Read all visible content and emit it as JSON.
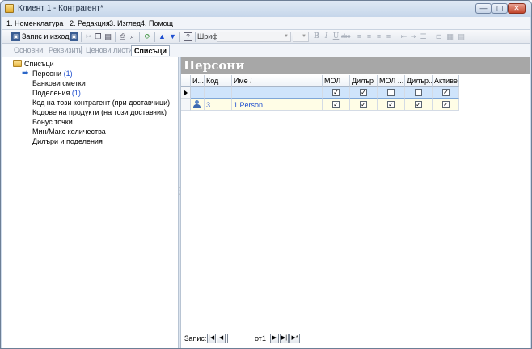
{
  "window": {
    "title": "Клиент 1 - Контрагент*",
    "min_glyph": "—",
    "max_glyph": "▢",
    "close_glyph": "✕"
  },
  "menu": [
    {
      "key": "1",
      "label": "1. Номенклатура"
    },
    {
      "key": "2",
      "label": "2. Редакция"
    },
    {
      "key": "3",
      "label": "3. Изглед"
    },
    {
      "key": "4",
      "label": "4. Помощ"
    }
  ],
  "toolbar": {
    "save_exit_label": "Запис и изход",
    "font_label": "Шрифт:",
    "bold": "B",
    "italic": "I",
    "underline": "U",
    "strike": "abc"
  },
  "tabs": [
    {
      "label": "Основни",
      "active": false
    },
    {
      "label": "Реквизити",
      "active": false
    },
    {
      "label": "Ценови листи",
      "active": false
    },
    {
      "label": "Списъци",
      "active": true
    }
  ],
  "tree": {
    "root": "Списъци",
    "items": [
      {
        "label": "Персони",
        "count": "(1)",
        "selected": true
      },
      {
        "label": "Банкови сметки",
        "count": ""
      },
      {
        "label": "Поделения",
        "count": "(1)"
      },
      {
        "label": "Код на този контрагент (при доставчици)",
        "count": ""
      },
      {
        "label": "Кодове на продукти (на този доставчик)",
        "count": ""
      },
      {
        "label": "Бонус точки",
        "count": ""
      },
      {
        "label": "Мин/Макс количества",
        "count": ""
      },
      {
        "label": "Дилъри и поделения",
        "count": ""
      }
    ]
  },
  "grid": {
    "title": "Персони",
    "columns": [
      "И...",
      "Код",
      "Име",
      "МОЛ",
      "Дилър",
      "МОЛ ...",
      "Дилър...",
      "Активен"
    ],
    "sort_glyph": "/",
    "new_row": {
      "mol": true,
      "dealer": true,
      "mol2": false,
      "dealer2": false,
      "active": true
    },
    "rows": [
      {
        "code": "3",
        "name": "1 Person",
        "mol": true,
        "dealer": true,
        "mol2": true,
        "dealer2": true,
        "active": true
      }
    ]
  },
  "navigator": {
    "label": "Запис:",
    "of": "от",
    "total": "1",
    "first": "|◀",
    "prev": "◀",
    "next": "▶",
    "last": "▶|",
    "new": "▶*"
  }
}
